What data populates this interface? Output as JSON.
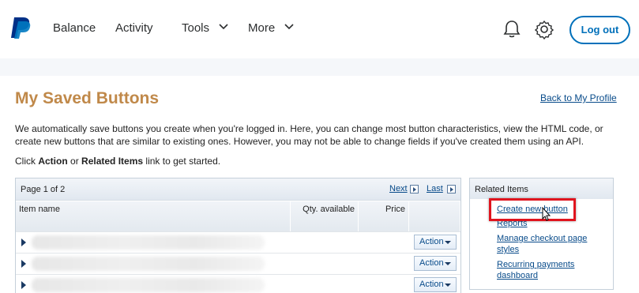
{
  "nav": {
    "items": [
      {
        "label": "Balance"
      },
      {
        "label": "Activity"
      },
      {
        "label": "Tools"
      },
      {
        "label": "More"
      }
    ],
    "logout_label": "Log out"
  },
  "page": {
    "title": "My Saved Buttons",
    "back_link": "Back to My Profile",
    "intro": "We automatically save buttons you create when you're logged in. Here, you can change most button characteristics, view the HTML code, or create new buttons that are similar to existing ones. However, you may not be able to change fields if you've created them using an API.",
    "click_prefix": "Click ",
    "click_action": "Action",
    "click_or": " or ",
    "click_related": "Related Items",
    "click_suffix": " link to get started."
  },
  "table": {
    "page_status": "Page 1 of 2",
    "next_label": "Next",
    "last_label": "Last",
    "columns": [
      "Item name",
      "Qty. available",
      "Price"
    ],
    "rows": [
      {
        "action_label": "Action"
      },
      {
        "action_label": "Action"
      },
      {
        "action_label": "Action"
      }
    ]
  },
  "related": {
    "heading": "Related Items",
    "links": [
      {
        "label": "Create new button"
      },
      {
        "label": "Reports"
      },
      {
        "label": "Manage checkout page styles"
      },
      {
        "label": "Recurring payments dashboard"
      }
    ]
  },
  "colors": {
    "title": "#c0894a",
    "link": "#084b8a",
    "brand_blue": "#0070ba",
    "highlight": "#e0141e"
  }
}
